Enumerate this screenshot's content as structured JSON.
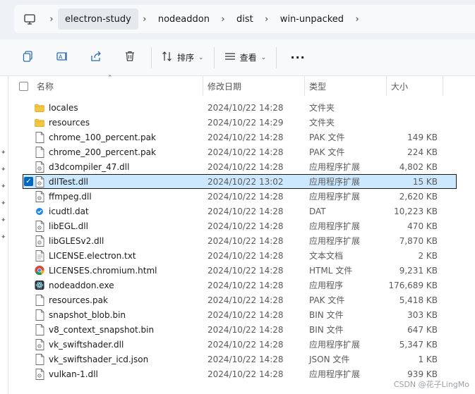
{
  "breadcrumb": {
    "pc_icon": "monitor-icon",
    "items": [
      "electron-study",
      "nodeaddon",
      "dist",
      "win-unpacked"
    ]
  },
  "toolbar": {
    "copy_icon": "copy-icon",
    "rename_icon": "rename-icon",
    "share_icon": "share-icon",
    "delete_icon": "trash-icon",
    "sort_label": "排序",
    "view_label": "查看",
    "more_icon": "more-icon"
  },
  "columns": {
    "name": "名称",
    "date": "修改日期",
    "type": "类型",
    "size": "大小"
  },
  "files": [
    {
      "name": "locales",
      "date": "2024/10/22 14:28",
      "type": "文件夹",
      "size": "",
      "icon": "folder-icon"
    },
    {
      "name": "resources",
      "date": "2024/10/22 14:29",
      "type": "文件夹",
      "size": "",
      "icon": "folder-icon"
    },
    {
      "name": "chrome_100_percent.pak",
      "date": "2024/10/22 14:28",
      "type": "PAK 文件",
      "size": "149 KB",
      "icon": "file-icon"
    },
    {
      "name": "chrome_200_percent.pak",
      "date": "2024/10/22 14:28",
      "type": "PAK 文件",
      "size": "224 KB",
      "icon": "file-icon"
    },
    {
      "name": "d3dcompiler_47.dll",
      "date": "2024/10/22 14:28",
      "type": "应用程序扩展",
      "size": "4,802 KB",
      "icon": "dll-icon"
    },
    {
      "name": "dllTest.dll",
      "date": "2024/10/22 13:02",
      "type": "应用程序扩展",
      "size": "15 KB",
      "icon": "dll-icon",
      "selected": true
    },
    {
      "name": "ffmpeg.dll",
      "date": "2024/10/22 14:28",
      "type": "应用程序扩展",
      "size": "2,620 KB",
      "icon": "dll-icon"
    },
    {
      "name": "icudtl.dat",
      "date": "2024/10/22 14:28",
      "type": "DAT",
      "size": "10,223 KB",
      "icon": "dat-icon"
    },
    {
      "name": "libEGL.dll",
      "date": "2024/10/22 14:28",
      "type": "应用程序扩展",
      "size": "470 KB",
      "icon": "dll-icon"
    },
    {
      "name": "libGLESv2.dll",
      "date": "2024/10/22 14:28",
      "type": "应用程序扩展",
      "size": "7,870 KB",
      "icon": "dll-icon"
    },
    {
      "name": "LICENSE.electron.txt",
      "date": "2024/10/22 14:28",
      "type": "文本文档",
      "size": "2 KB",
      "icon": "text-file-icon"
    },
    {
      "name": "LICENSES.chromium.html",
      "date": "2024/10/22 14:28",
      "type": "HTML 文件",
      "size": "9,231 KB",
      "icon": "chrome-icon"
    },
    {
      "name": "nodeaddon.exe",
      "date": "2024/10/22 14:28",
      "type": "应用程序",
      "size": "176,689 KB",
      "icon": "electron-icon"
    },
    {
      "name": "resources.pak",
      "date": "2024/10/22 14:28",
      "type": "PAK 文件",
      "size": "5,418 KB",
      "icon": "file-icon"
    },
    {
      "name": "snapshot_blob.bin",
      "date": "2024/10/22 14:28",
      "type": "BIN 文件",
      "size": "303 KB",
      "icon": "file-icon"
    },
    {
      "name": "v8_context_snapshot.bin",
      "date": "2024/10/22 14:28",
      "type": "BIN 文件",
      "size": "647 KB",
      "icon": "file-icon"
    },
    {
      "name": "vk_swiftshader.dll",
      "date": "2024/10/22 14:28",
      "type": "应用程序扩展",
      "size": "5,347 KB",
      "icon": "dll-icon"
    },
    {
      "name": "vk_swiftshader_icd.json",
      "date": "2024/10/22 14:28",
      "type": "JSON 文件",
      "size": "1 KB",
      "icon": "file-icon"
    },
    {
      "name": "vulkan-1.dll",
      "date": "2024/10/22 14:28",
      "type": "应用程序扩展",
      "size": "939 KB",
      "icon": "dll-icon"
    }
  ],
  "watermark": "CSDN @花子LingMo",
  "colors": {
    "selection": "#cce8ff",
    "accent": "#0067c0",
    "folder": "#f4c542"
  }
}
